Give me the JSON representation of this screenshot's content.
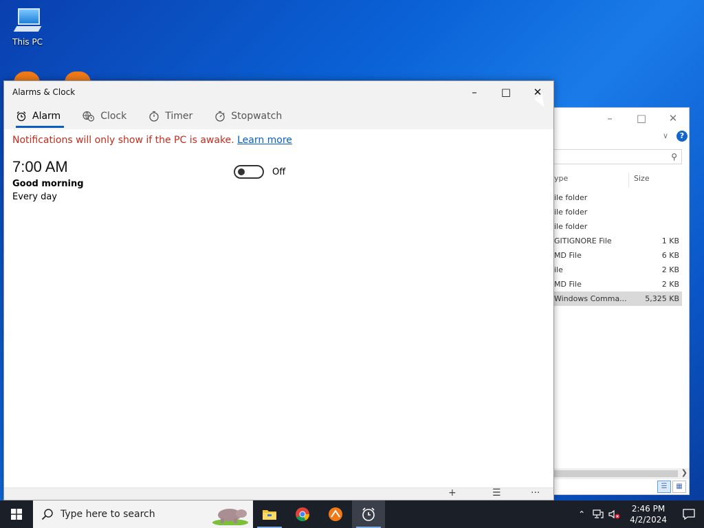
{
  "desktop": {
    "this_pc_label": "This PC"
  },
  "explorer": {
    "col_type": "ype",
    "col_size": "Size",
    "rows": [
      {
        "type": "ile folder",
        "size": ""
      },
      {
        "type": "ile folder",
        "size": ""
      },
      {
        "type": "ile folder",
        "size": ""
      },
      {
        "type": "GITIGNORE File",
        "size": "1 KB"
      },
      {
        "type": "MD File",
        "size": "6 KB"
      },
      {
        "type": "ile",
        "size": "2 KB"
      },
      {
        "type": "MD File",
        "size": "2 KB"
      },
      {
        "type": "Windows Comma...",
        "size": "5,325 KB"
      }
    ]
  },
  "window": {
    "title": "Alarms & Clock",
    "tabs": [
      {
        "label": "Alarm",
        "icon": "alarm-icon",
        "active": true
      },
      {
        "label": "Clock",
        "icon": "globe-clock-icon",
        "active": false
      },
      {
        "label": "Timer",
        "icon": "timer-icon",
        "active": false
      },
      {
        "label": "Stopwatch",
        "icon": "stopwatch-icon",
        "active": false
      }
    ],
    "notice": "Notifications will only show if the PC is awake.",
    "learn_more": "Learn more",
    "alarm": {
      "time": "7:00 AM",
      "name": "Good morning",
      "repeat": "Every day",
      "toggle_state": "Off"
    }
  },
  "taskbar": {
    "search_placeholder": "Type here to search",
    "clock_time": "2:46 PM",
    "clock_date": "4/2/2024"
  },
  "colors": {
    "accent": "#0a5cc2",
    "notice_red": "#c42b1c",
    "taskbar_bg": "#1b1f27"
  }
}
